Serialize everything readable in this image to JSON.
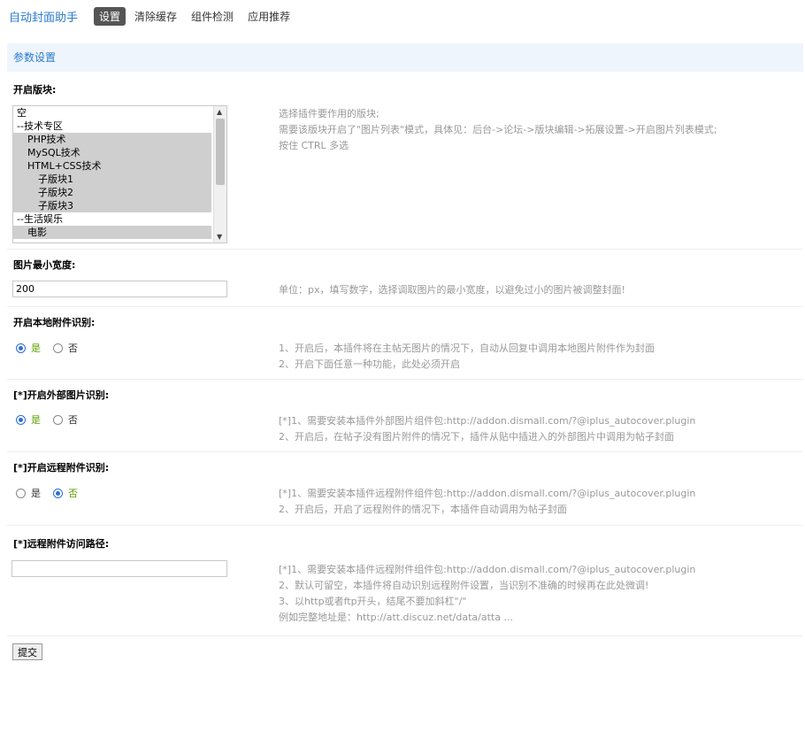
{
  "nav": {
    "brand": "自动封面助手",
    "items": [
      "设置",
      "清除缓存",
      "组件检测",
      "应用推荐"
    ],
    "active_index": 0
  },
  "section_title": "参数设置",
  "block_select": {
    "label": "开启版块:",
    "options": [
      {
        "text": "空",
        "indent": 0,
        "selected": false
      },
      {
        "text": "--技术专区",
        "indent": 0,
        "selected": false
      },
      {
        "text": "PHP技术",
        "indent": 1,
        "selected": true
      },
      {
        "text": "MySQL技术",
        "indent": 1,
        "selected": true
      },
      {
        "text": "HTML+CSS技术",
        "indent": 1,
        "selected": true
      },
      {
        "text": "子版块1",
        "indent": 2,
        "selected": true
      },
      {
        "text": "子版块2",
        "indent": 2,
        "selected": true
      },
      {
        "text": "子版块3",
        "indent": 2,
        "selected": true
      },
      {
        "text": "--生活娱乐",
        "indent": 0,
        "selected": false
      },
      {
        "text": "电影",
        "indent": 1,
        "selected": true
      }
    ],
    "hint": [
      "选择插件要作用的版块;",
      "需要该版块开启了\"图片列表\"模式，具体见：后台->论坛->版块编辑->拓展设置->开启图片列表模式;",
      "按住 CTRL 多选"
    ]
  },
  "min_width": {
    "label": "图片最小宽度:",
    "value": "200",
    "hint": "单位：px，填写数字，选择调取图片的最小宽度，以避免过小的图片被调整封面!"
  },
  "local_attach": {
    "label": "开启本地附件识别:",
    "yes": "是",
    "no": "否",
    "value": "yes",
    "hint": [
      "1、开启后，本插件将在主帖无图片的情况下，自动从回复中调用本地图片附件作为封面",
      "2、开启下面任意一种功能，此处必须开启"
    ]
  },
  "external_image": {
    "label": "[*]开启外部图片识别:",
    "yes": "是",
    "no": "否",
    "value": "yes",
    "hint": [
      "[*]1、需要安装本插件外部图片组件包:http://addon.dismall.com/?@iplus_autocover.plugin",
      "2、开启后，在帖子没有图片附件的情况下，插件从贴中插进入的外部图片中调用为帖子封面"
    ]
  },
  "remote_attach": {
    "label": "[*]开启远程附件识别:",
    "yes": "是",
    "no": "否",
    "value": "no",
    "hint": [
      "[*]1、需要安装本插件远程附件组件包:http://addon.dismall.com/?@iplus_autocover.plugin",
      "2、开启后，开启了远程附件的情况下，本插件自动调用为帖子封面"
    ]
  },
  "remote_path": {
    "label": "[*]远程附件访问路径:",
    "value": "",
    "hint": [
      "[*]1、需要安装本插件远程附件组件包:http://addon.dismall.com/?@iplus_autocover.plugin",
      "2、默认可留空，本插件将自动识别远程附件设置，当识别不准确的时候再在此处微调!",
      "3、以http或者ftp开头，结尾不要加斜杠\"/\"",
      "例如完整地址是：http://att.discuz.net/data/atta ..."
    ]
  },
  "submit_label": "提交",
  "colors": {
    "accent": "#2b7acd",
    "header_bg": "#eef5fc",
    "radio_on": "#2b6ed6",
    "yes_green": "#5aa000"
  }
}
